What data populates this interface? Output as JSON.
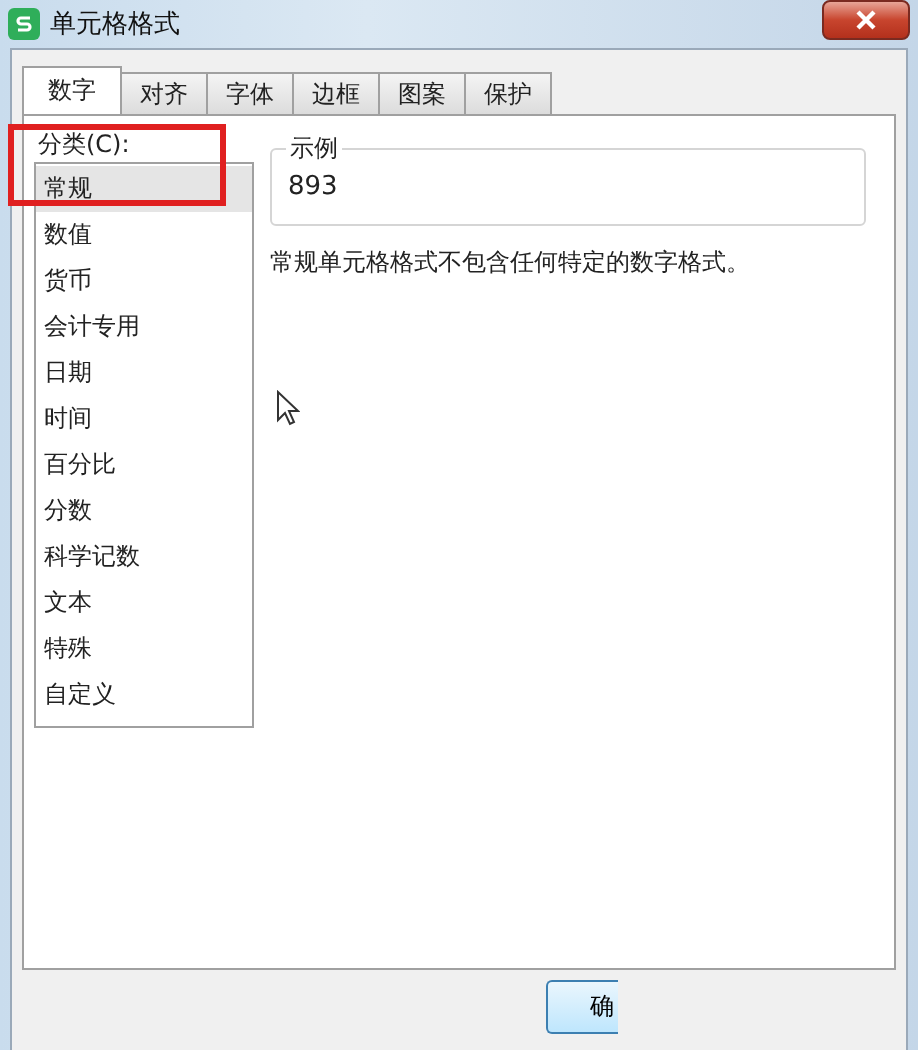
{
  "window": {
    "title": "单元格格式"
  },
  "tabs": [
    {
      "label": "数字",
      "selected": true
    },
    {
      "label": "对齐",
      "selected": false
    },
    {
      "label": "字体",
      "selected": false
    },
    {
      "label": "边框",
      "selected": false
    },
    {
      "label": "图案",
      "selected": false
    },
    {
      "label": "保护",
      "selected": false
    }
  ],
  "category": {
    "label": "分类(C):",
    "items": [
      {
        "label": "常规",
        "selected": true
      },
      {
        "label": "数值",
        "selected": false
      },
      {
        "label": "货币",
        "selected": false
      },
      {
        "label": "会计专用",
        "selected": false
      },
      {
        "label": "日期",
        "selected": false
      },
      {
        "label": "时间",
        "selected": false
      },
      {
        "label": "百分比",
        "selected": false
      },
      {
        "label": "分数",
        "selected": false
      },
      {
        "label": "科学记数",
        "selected": false
      },
      {
        "label": "文本",
        "selected": false
      },
      {
        "label": "特殊",
        "selected": false
      },
      {
        "label": "自定义",
        "selected": false
      }
    ]
  },
  "sample": {
    "label": "示例",
    "value": "893"
  },
  "description": "常规单元格格式不包含任何特定的数字格式。",
  "buttons": [
    "确"
  ]
}
